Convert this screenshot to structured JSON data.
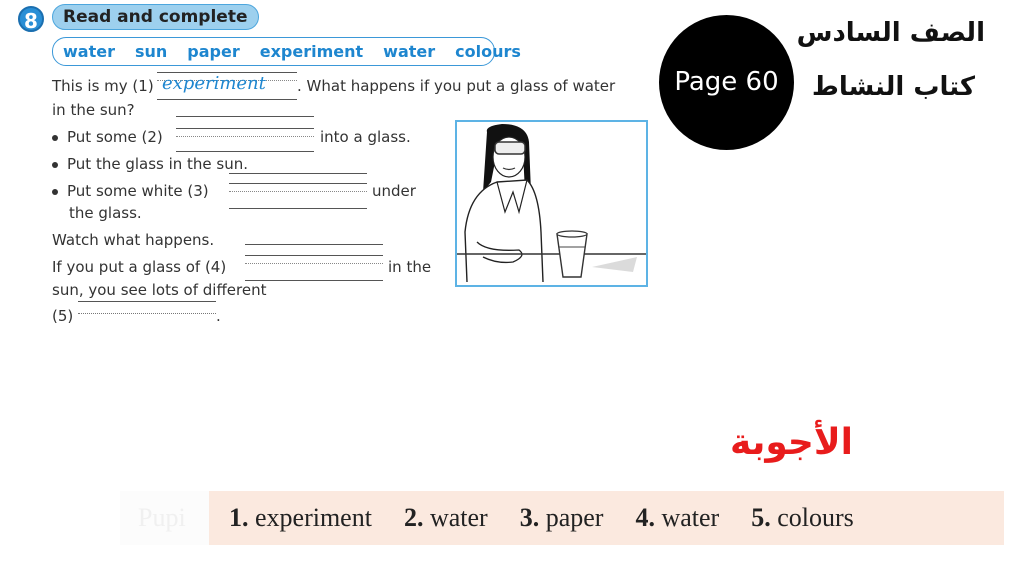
{
  "exercise": {
    "number": "8",
    "title": "Read and complete",
    "word_bank": [
      "water",
      "sun",
      "paper",
      "experiment",
      "water",
      "colours"
    ]
  },
  "text": {
    "line1_prefix": "This is my (1)",
    "line1_answer": "experiment",
    "line1_suffix": ". What happens if you put a glass of water",
    "line2": "in the sun?",
    "bullet1_prefix": "Put some (2)",
    "bullet1_suffix": "into a glass.",
    "bullet2": "Put the glass in the sun.",
    "bullet3_prefix": "Put some white (3)",
    "bullet3_suffix": "under",
    "bullet3_cont": "the glass.",
    "watch": "Watch what happens.",
    "if_prefix": "If you put a glass of (4)",
    "if_suffix": "in the",
    "sun_line": "sun, you see lots of different",
    "five_prefix": "(5)",
    "five_suffix": "."
  },
  "picture": {
    "description": "girl-in-lab-coat-with-goggles-and-glass-of-water"
  },
  "page_badge": {
    "label": "Page 60"
  },
  "arabic": {
    "grade": "الصف السادس",
    "book": "كتاب النشاط",
    "answers_heading": "الأجوبة"
  },
  "answers": {
    "ghost_text": "Pupi",
    "items": [
      {
        "num": "1.",
        "word": "experiment"
      },
      {
        "num": "2.",
        "word": "water"
      },
      {
        "num": "3.",
        "word": "paper"
      },
      {
        "num": "4.",
        "word": "water"
      },
      {
        "num": "5.",
        "word": "colours"
      }
    ]
  }
}
